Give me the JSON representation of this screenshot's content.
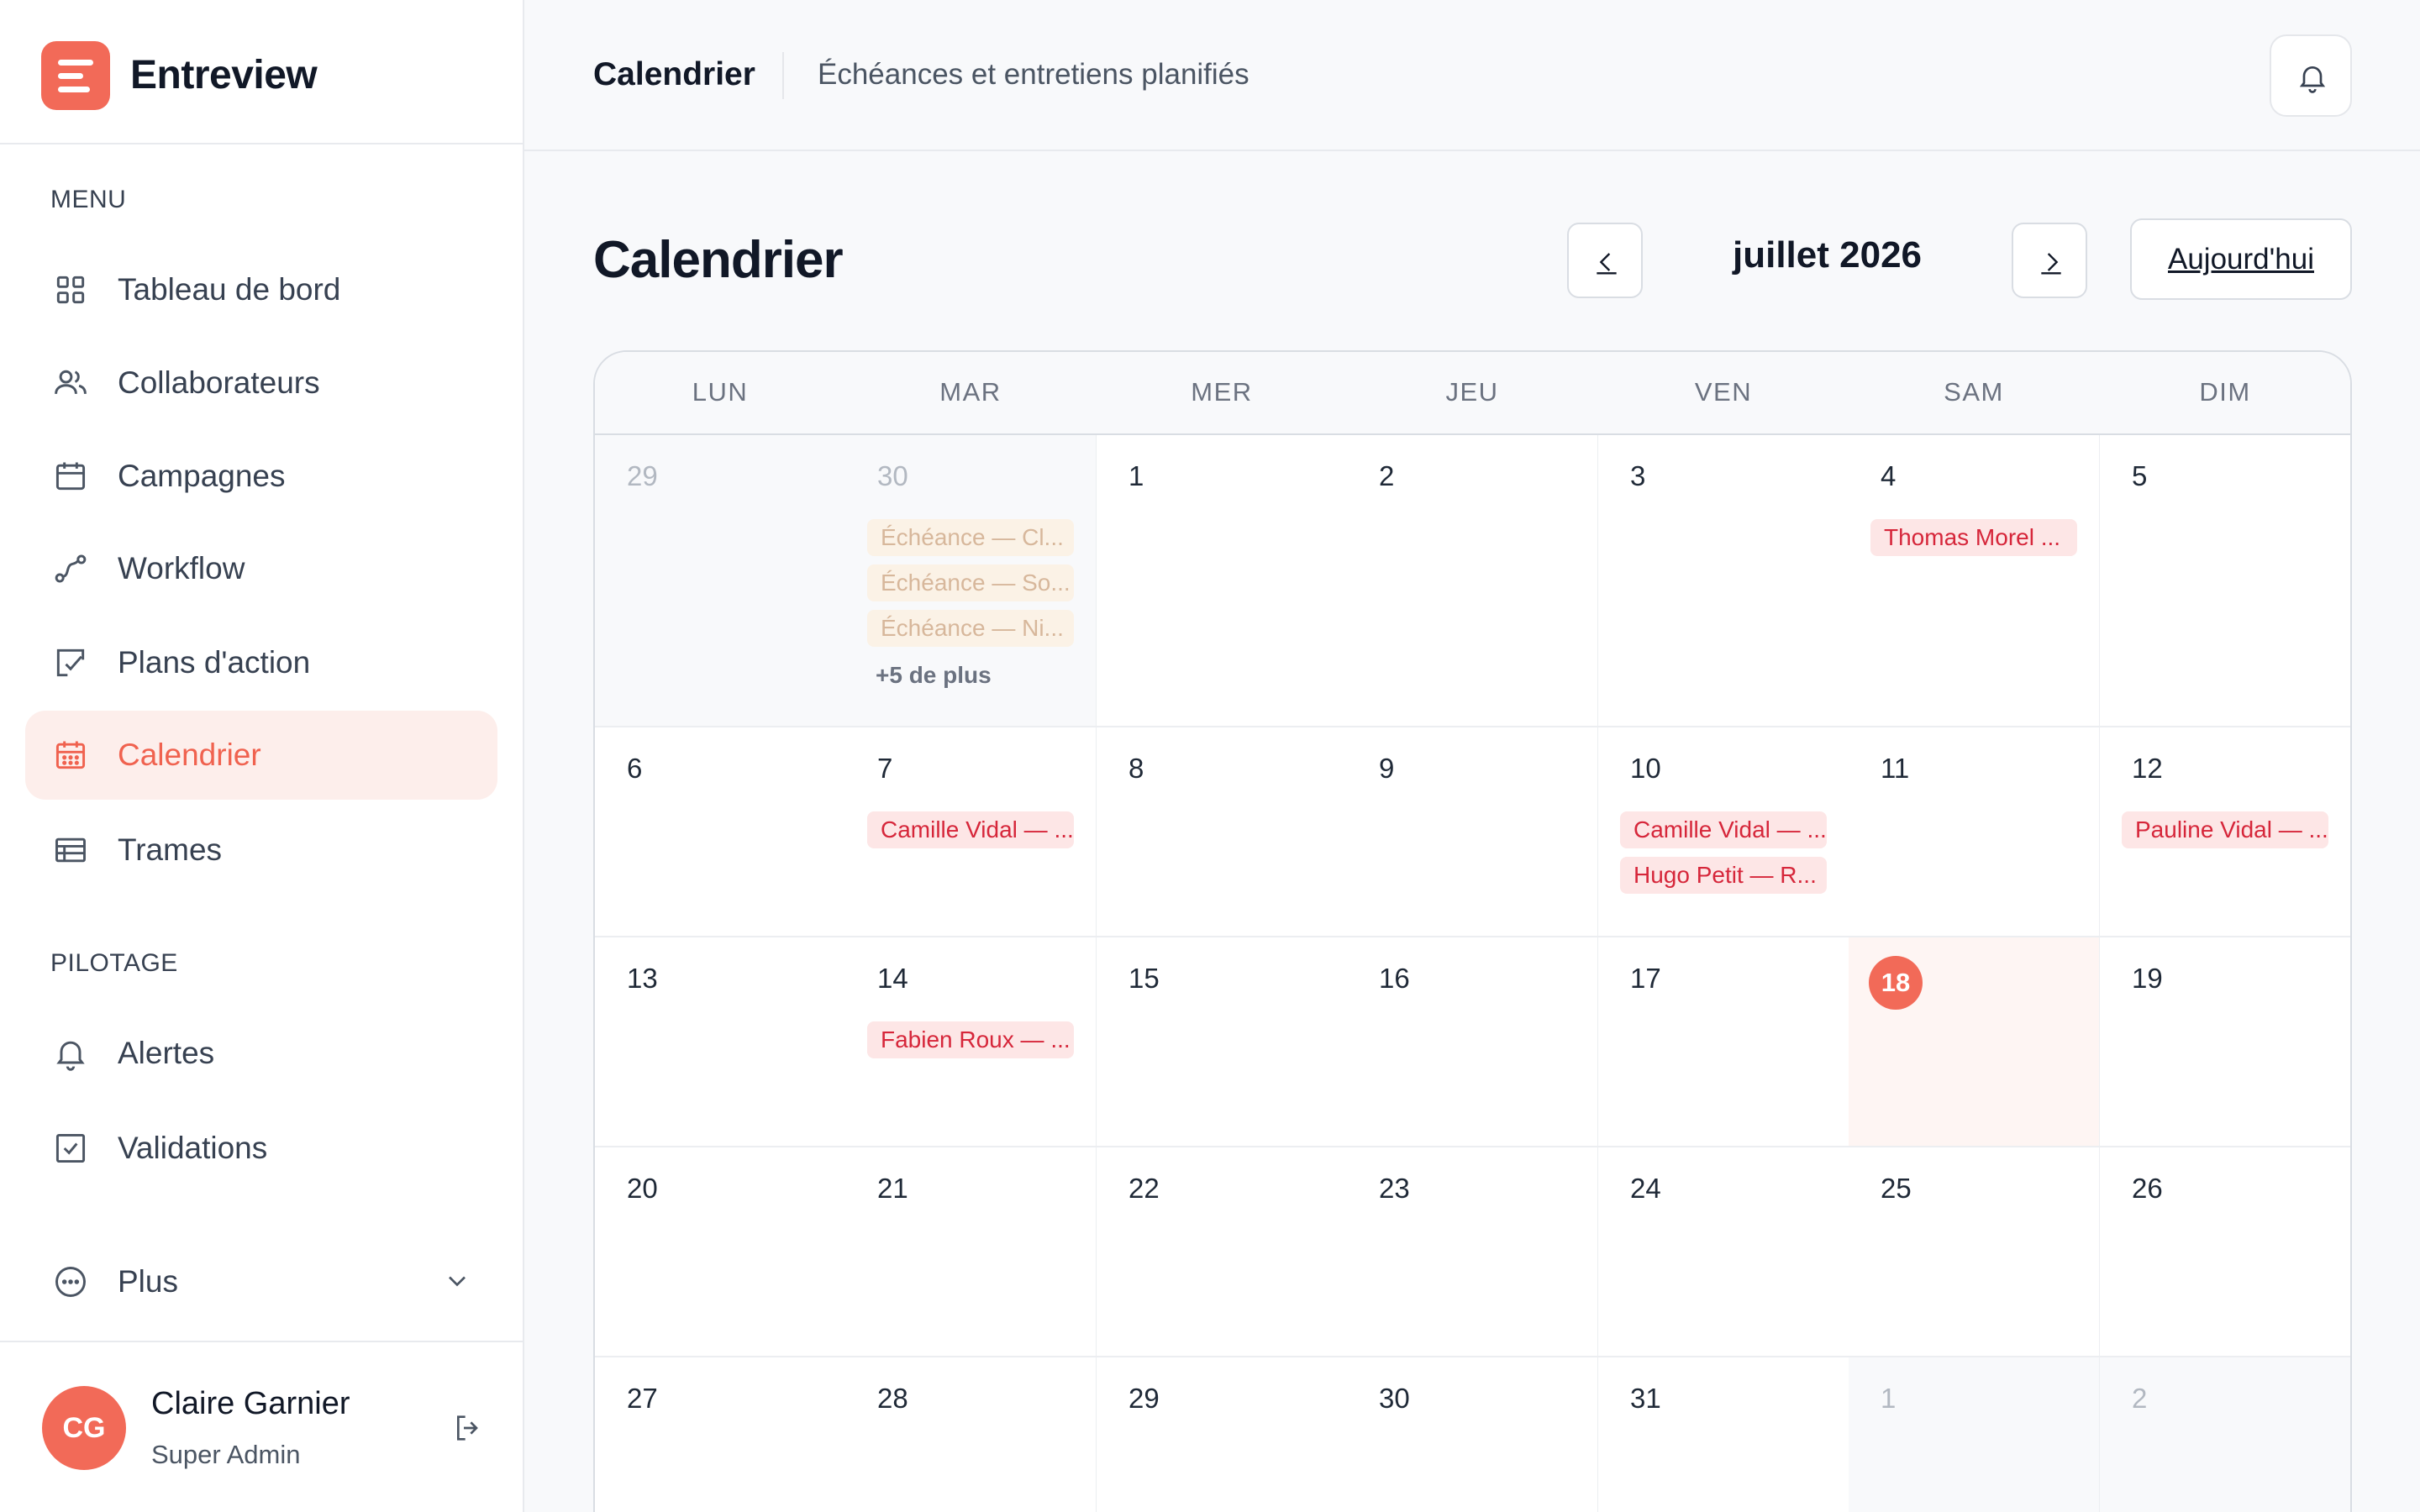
{
  "app": {
    "name": "Entreview"
  },
  "sidebar": {
    "menu_label": "MENU",
    "menu_items": [
      {
        "label": "Tableau de bord",
        "icon": "grid-icon",
        "active": false
      },
      {
        "label": "Collaborateurs",
        "icon": "users-icon",
        "active": false
      },
      {
        "label": "Campagnes",
        "icon": "calendar-plain-icon",
        "active": false
      },
      {
        "label": "Workflow",
        "icon": "workflow-icon",
        "active": false
      },
      {
        "label": "Plans d'action",
        "icon": "action-plan-icon",
        "active": false
      },
      {
        "label": "Calendrier",
        "icon": "calendar-dots-icon",
        "active": true
      },
      {
        "label": "Trames",
        "icon": "table-icon",
        "active": false
      }
    ],
    "pilotage_label": "PILOTAGE",
    "pilotage_items": [
      {
        "label": "Alertes",
        "icon": "bell-icon"
      },
      {
        "label": "Validations",
        "icon": "check-square-icon"
      }
    ],
    "more": {
      "label": "Plus",
      "icon": "more-dots-icon"
    },
    "user": {
      "initials": "CG",
      "name": "Claire Garnier",
      "role": "Super Admin"
    }
  },
  "header": {
    "title": "Calendrier",
    "subtitle": "Échéances et entretiens planifiés"
  },
  "page": {
    "title": "Calendrier",
    "month": "juillet 2026",
    "today_button": "Aujourd'hui"
  },
  "colors": {
    "accent": "#f26a58",
    "accent_soft": "#fdeeeb",
    "event_bg": "#fde6e6",
    "event_text": "#d6263a"
  },
  "calendar": {
    "weekdays": [
      "LUN",
      "MAR",
      "MER",
      "JEU",
      "VEN",
      "SAM",
      "DIM"
    ],
    "today": "18",
    "weeks": [
      [
        {
          "day": "29",
          "outside": true,
          "events": []
        },
        {
          "day": "30",
          "outside": true,
          "events": [
            "Échéance — Cl...",
            "Échéance — So...",
            "Échéance — Ni..."
          ],
          "more": "+5 de plus"
        },
        {
          "day": "1",
          "events": []
        },
        {
          "day": "2",
          "events": []
        },
        {
          "day": "3",
          "events": []
        },
        {
          "day": "4",
          "events": [
            "Thomas Morel ..."
          ]
        },
        {
          "day": "5",
          "events": []
        }
      ],
      [
        {
          "day": "6",
          "events": []
        },
        {
          "day": "7",
          "events": [
            "Camille Vidal — ..."
          ]
        },
        {
          "day": "8",
          "events": []
        },
        {
          "day": "9",
          "events": []
        },
        {
          "day": "10",
          "events": [
            "Camille Vidal — ...",
            "Hugo Petit — R..."
          ]
        },
        {
          "day": "11",
          "events": []
        },
        {
          "day": "12",
          "events": [
            "Pauline Vidal — ..."
          ]
        }
      ],
      [
        {
          "day": "13",
          "events": []
        },
        {
          "day": "14",
          "events": [
            "Fabien Roux — ..."
          ]
        },
        {
          "day": "15",
          "events": []
        },
        {
          "day": "16",
          "events": []
        },
        {
          "day": "17",
          "events": []
        },
        {
          "day": "18",
          "today": true,
          "events": []
        },
        {
          "day": "19",
          "events": []
        }
      ],
      [
        {
          "day": "20",
          "events": []
        },
        {
          "day": "21",
          "events": []
        },
        {
          "day": "22",
          "events": []
        },
        {
          "day": "23",
          "events": []
        },
        {
          "day": "24",
          "events": []
        },
        {
          "day": "25",
          "events": []
        },
        {
          "day": "26",
          "events": []
        }
      ],
      [
        {
          "day": "27",
          "events": []
        },
        {
          "day": "28",
          "events": []
        },
        {
          "day": "29",
          "events": []
        },
        {
          "day": "30",
          "events": []
        },
        {
          "day": "31",
          "events": []
        },
        {
          "day": "1",
          "outside": true,
          "events": []
        },
        {
          "day": "2",
          "outside": true,
          "events": []
        }
      ]
    ]
  }
}
